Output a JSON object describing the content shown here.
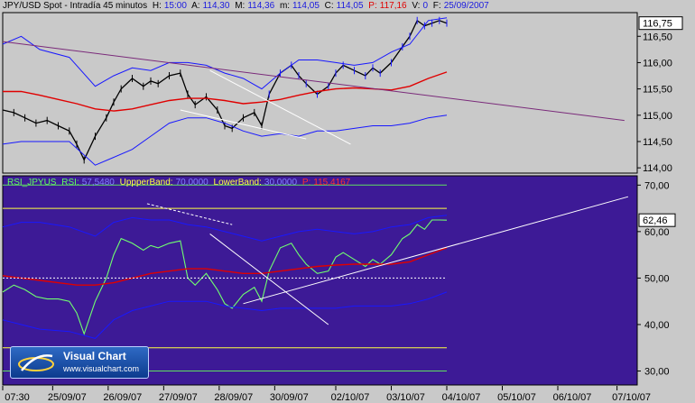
{
  "header": {
    "symbol": "JPY/USD Spot - Intradía 45 minutos",
    "h_label": "H:",
    "h_value": "15:00",
    "a_label": "A:",
    "a_value": "114,30",
    "m_label": "M:",
    "m_value": "114,36",
    "mn_label": "m:",
    "mn_value": "114,05",
    "c_label": "C:",
    "c_value": "114,05",
    "p_label": "P:",
    "p_value": "117,16",
    "v_label": "V:",
    "v_value": "0",
    "f_label": "F:",
    "f_value": "25/09/2007"
  },
  "rsi_header": {
    "name": "RSI_JPYUS",
    "rsi_label": "RSI:",
    "rsi_value": "57,5480",
    "upper_label": "UppperBand:",
    "upper_value": "70,0000",
    "lower_label": "LowerBand:",
    "lower_value": "30,0000",
    "p_label": "P:",
    "p_value": "115,4167"
  },
  "logo": {
    "title": "Visual Chart",
    "url": "www.visualchart.com"
  },
  "colors": {
    "price_bg": "#c9c9c9",
    "rsi_bg": "#3d1a96",
    "bollinger": "#1818ff",
    "moving_average": "#e00000",
    "trendline": "#7a2a7a",
    "rsi_line": "#70ff70",
    "band_yellow": "#ffff40",
    "band_green": "#60e060"
  },
  "chart_data": [
    {
      "type": "line",
      "title": "JPY/USD Spot - Intradía 45 minutos",
      "x_tick_labels": [
        "07:30",
        "25/09/07",
        "26/09/07",
        "27/09/07",
        "28/09/07",
        "30/09/07",
        "02/10/07",
        "03/10/07",
        "04/10/07",
        "05/10/07",
        "06/10/07",
        "07/10/07"
      ],
      "y_tick_labels": [
        "116,50",
        "116,00",
        "115,50",
        "115,00",
        "114,50",
        "114,00"
      ],
      "ylim": [
        113.9,
        116.95
      ],
      "last_value_label": "116,75",
      "series": [
        {
          "name": "price",
          "x": [
            0,
            3,
            6,
            9,
            12,
            15,
            18,
            20,
            22,
            25,
            28,
            30,
            32,
            35,
            38,
            40,
            42,
            45,
            48,
            50,
            52,
            55,
            58,
            60,
            62,
            65,
            68,
            70,
            72,
            75,
            78,
            80,
            82,
            85,
            88,
            90,
            92,
            95,
            98,
            100,
            102,
            105,
            108,
            110,
            112,
            114,
            116,
            118,
            120
          ],
          "y": [
            115.1,
            115.05,
            114.95,
            114.85,
            114.9,
            114.8,
            114.7,
            114.45,
            114.15,
            114.6,
            114.95,
            115.25,
            115.5,
            115.7,
            115.55,
            115.65,
            115.6,
            115.75,
            115.8,
            115.4,
            115.2,
            115.35,
            115.1,
            114.8,
            114.75,
            114.95,
            115.05,
            114.8,
            115.4,
            115.8,
            115.95,
            115.75,
            115.6,
            115.4,
            115.55,
            115.8,
            115.95,
            115.85,
            115.75,
            115.9,
            115.8,
            116.0,
            116.3,
            116.5,
            116.8,
            116.7,
            116.75,
            116.8,
            116.75
          ]
        },
        {
          "name": "bollinger-upper",
          "x": [
            0,
            5,
            10,
            18,
            25,
            30,
            35,
            40,
            45,
            50,
            55,
            60,
            65,
            70,
            75,
            80,
            85,
            90,
            95,
            100,
            105,
            110,
            115,
            120
          ],
          "y": [
            116.35,
            116.5,
            116.25,
            116.1,
            115.55,
            115.75,
            115.9,
            115.85,
            116.0,
            116.0,
            115.95,
            115.8,
            115.7,
            115.5,
            115.8,
            116.05,
            116.05,
            116.0,
            115.95,
            116.0,
            116.2,
            116.35,
            116.8,
            116.85
          ]
        },
        {
          "name": "bollinger-lower",
          "x": [
            0,
            5,
            10,
            18,
            25,
            30,
            35,
            40,
            45,
            50,
            55,
            60,
            65,
            70,
            75,
            80,
            85,
            90,
            95,
            100,
            105,
            110,
            115,
            120
          ],
          "y": [
            114.45,
            114.5,
            114.5,
            114.5,
            114.05,
            114.2,
            114.35,
            114.6,
            114.85,
            114.95,
            114.95,
            114.85,
            114.7,
            114.6,
            114.65,
            114.6,
            114.7,
            114.7,
            114.75,
            114.8,
            114.8,
            114.85,
            114.95,
            115.0
          ]
        },
        {
          "name": "moving-average",
          "x": [
            0,
            5,
            10,
            15,
            20,
            25,
            30,
            35,
            40,
            45,
            50,
            55,
            60,
            65,
            70,
            75,
            80,
            85,
            90,
            95,
            100,
            105,
            110,
            115,
            120
          ],
          "y": [
            115.45,
            115.45,
            115.38,
            115.3,
            115.22,
            115.12,
            115.08,
            115.12,
            115.2,
            115.28,
            115.32,
            115.32,
            115.28,
            115.22,
            115.25,
            115.3,
            115.38,
            115.45,
            115.5,
            115.52,
            115.5,
            115.48,
            115.55,
            115.7,
            115.82
          ]
        },
        {
          "name": "trendline",
          "x": [
            0,
            168
          ],
          "y": [
            116.4,
            114.9
          ]
        }
      ]
    },
    {
      "type": "line",
      "y_tick_labels": [
        "70,00",
        "60,00",
        "50,00",
        "40,00",
        "30,00"
      ],
      "ylim": [
        27,
        72
      ],
      "last_value_label": "62,46",
      "series": [
        {
          "name": "RSI",
          "x": [
            0,
            3,
            6,
            9,
            12,
            15,
            18,
            20,
            22,
            25,
            28,
            30,
            32,
            35,
            38,
            40,
            42,
            45,
            48,
            50,
            52,
            55,
            58,
            60,
            62,
            65,
            68,
            70,
            72,
            75,
            78,
            80,
            82,
            85,
            88,
            90,
            92,
            95,
            98,
            100,
            102,
            105,
            108,
            110,
            112,
            114,
            116,
            118,
            120
          ],
          "y": [
            47,
            48.5,
            47.5,
            46,
            45.5,
            45.5,
            45,
            42.5,
            38,
            45,
            50,
            55,
            58.5,
            57.5,
            56,
            57,
            56.5,
            57.5,
            58,
            50,
            48.5,
            51,
            47.5,
            44.5,
            43.5,
            46.5,
            48,
            45,
            51.5,
            56.5,
            57.5,
            55,
            53,
            51,
            51.5,
            54.5,
            55.5,
            54,
            52.5,
            54,
            53,
            55,
            58.5,
            59.5,
            61.5,
            60.5,
            62.5,
            62.5,
            62.46
          ]
        },
        {
          "name": "rsi-upper",
          "x": [
            0,
            5,
            10,
            18,
            25,
            30,
            35,
            40,
            45,
            50,
            55,
            60,
            65,
            70,
            75,
            80,
            85,
            90,
            95,
            100,
            105,
            110,
            115,
            120
          ],
          "y": [
            61,
            62,
            62,
            61,
            59,
            62,
            63,
            62.5,
            62.5,
            61.5,
            61,
            60,
            59,
            58,
            59,
            60,
            60.5,
            60,
            59.5,
            60,
            61,
            61.5,
            63,
            63.5
          ]
        },
        {
          "name": "rsi-lower",
          "x": [
            0,
            5,
            10,
            18,
            25,
            30,
            35,
            40,
            45,
            50,
            55,
            60,
            65,
            70,
            75,
            80,
            85,
            90,
            95,
            100,
            105,
            110,
            115,
            120
          ],
          "y": [
            41,
            40,
            39,
            38.5,
            37,
            41,
            43,
            44,
            45,
            45,
            45,
            44,
            43.5,
            43,
            43.5,
            43.5,
            43.5,
            43.5,
            44,
            44,
            44,
            44.5,
            45.5,
            47
          ]
        },
        {
          "name": "rsi-average",
          "x": [
            0,
            5,
            10,
            15,
            20,
            25,
            30,
            35,
            40,
            45,
            50,
            55,
            60,
            65,
            70,
            75,
            80,
            85,
            90,
            95,
            100,
            105,
            110,
            115,
            120
          ],
          "y": [
            50.5,
            50,
            49.5,
            49,
            48.5,
            48.5,
            49,
            50,
            51,
            51.5,
            52,
            52,
            51.5,
            51,
            51,
            51.5,
            52,
            52.5,
            52.8,
            53,
            53,
            53,
            53.5,
            55,
            56.5
          ]
        },
        {
          "name": "upper-band-70",
          "x": [
            0,
            120
          ],
          "y": [
            70,
            70
          ]
        },
        {
          "name": "lower-band-30",
          "x": [
            0,
            120
          ],
          "y": [
            30,
            30
          ]
        },
        {
          "name": "reference-65",
          "x": [
            0,
            120
          ],
          "y": [
            65,
            65
          ]
        },
        {
          "name": "reference-35",
          "x": [
            0,
            120
          ],
          "y": [
            35,
            35
          ]
        },
        {
          "name": "midline-50",
          "x": [
            0,
            120
          ],
          "y": [
            50,
            50
          ]
        },
        {
          "name": "trendline",
          "x": [
            65,
            169
          ],
          "y": [
            44.5,
            67.5
          ]
        }
      ]
    }
  ]
}
